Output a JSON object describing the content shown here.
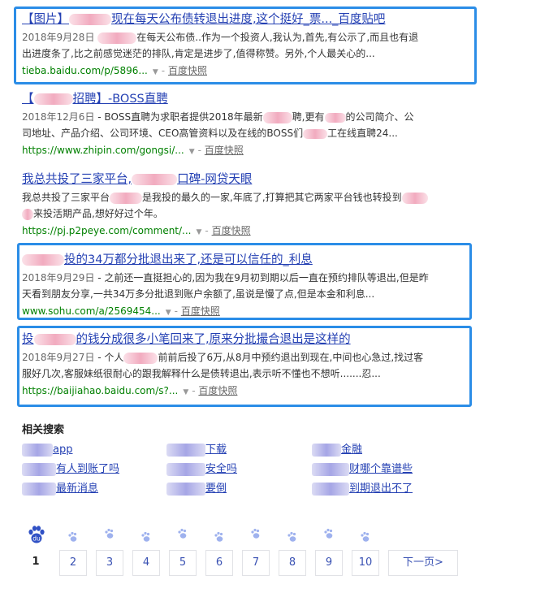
{
  "results": [
    {
      "title_prefix": "【图片】",
      "title_suffix": "现在每天公布债转退出进度,这个挺好_票..._百度贴吧",
      "date": "2018年9月28日",
      "abstract_a": "在每天公布债..作为一个投资人,我认为,首先,有公示了,而且也有退",
      "abstract_b": "出进度条了,比之前感觉迷茫的排队,肯定是进步了,值得称赞。另外,个人最关心的...",
      "url": "tieba.baidu.com/p/5896...",
      "snapshot": "百度快照"
    },
    {
      "title_prefix": "【",
      "title_suffix": "招聘】-BOSS直聘",
      "date": "2018年12月6日",
      "abstract_a": "- BOSS直聘为求职者提供2018年最新",
      "abstract_a2": "聘,更有",
      "abstract_a3": "的公司简介、公",
      "abstract_b": "司地址、产品介绍、公司环境、CEO高管资料以及在线的BOSS们",
      "abstract_b2": "工在线直聘24...",
      "url": "https://www.zhipin.com/gongsi/...",
      "snapshot": "百度快照"
    },
    {
      "title_prefix": "我总共投了三家平台,",
      "title_suffix": "口碑-网贷天眼",
      "abstract_a": "我总共投了三家平台",
      "abstract_a2": "是我投的最久的一家,年底了,打算把其它两家平台钱也转投到",
      "abstract_b": "来投活期产品,想好好过个年。",
      "url": "https://pj.p2peye.com/comment/...",
      "snapshot": "百度快照"
    },
    {
      "title_suffix": "投的34万都分批退出来了,还是可以信任的_利息",
      "date": "2018年9月29日",
      "abstract_a": "- 之前还一直挺担心的,因为我在9月初到期以后一直在预约排队等退出,但是昨",
      "abstract_b": "天看到朋友分享,一共34万多分批退到账户余额了,虽说是慢了点,但是本金和利息...",
      "url": "www.sohu.com/a/2569454...",
      "snapshot": "百度快照"
    },
    {
      "title_prefix": "投",
      "title_suffix": "的钱分成很多小笔回来了,原来分批撮合退出是这样的",
      "date": "2018年9月27日",
      "abstract_a": "- 个人",
      "abstract_a2": "前前后投了6万,从8月中预约退出到现在,中间也心急过,找过客",
      "abstract_b": "服好几次,客服妹纸很耐心的跟我解释什么是债转退出,表示听不懂也不想听.......忍...",
      "url": "https://baijiahao.baidu.com/s?...",
      "snapshot": "百度快照"
    }
  ],
  "related": {
    "title": "相关搜索",
    "items": [
      {
        "suffix": "app"
      },
      {
        "suffix": "下载"
      },
      {
        "suffix": "金融"
      },
      {
        "suffix": "有人到账了吗"
      },
      {
        "suffix": "安全吗"
      },
      {
        "suffix": "财哪个靠谱些"
      },
      {
        "suffix": "最新消息"
      },
      {
        "suffix": "要倒"
      },
      {
        "suffix": "到期退出不了"
      }
    ]
  },
  "pagination": {
    "logo_text": "du",
    "current": "1",
    "pages": [
      "2",
      "3",
      "4",
      "5",
      "6",
      "7",
      "8",
      "9",
      "10"
    ],
    "next": "下一页>"
  },
  "colors": {
    "link": "#2440b3",
    "url": "#008000",
    "highlight": "#2b8de7",
    "paw_current": "#3051c5",
    "paw_other": "#9fb2ee"
  },
  "icons": [
    "paw-logo-icon",
    "paw-icon",
    "dropdown-arrow-icon",
    "redaction-blur"
  ]
}
